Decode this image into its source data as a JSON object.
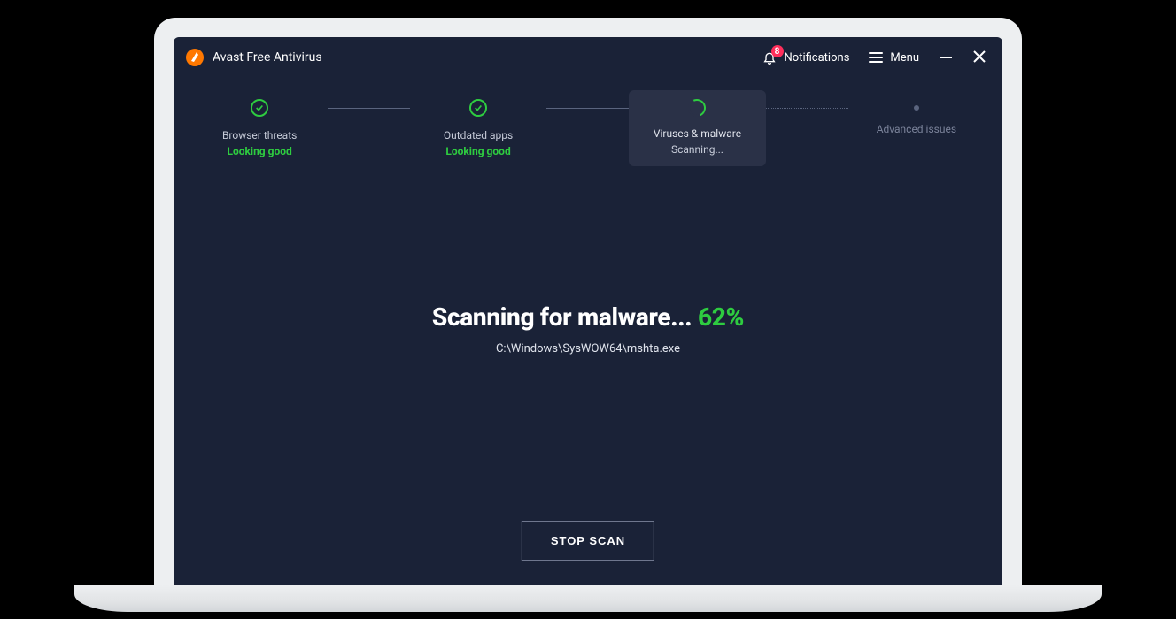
{
  "app": {
    "title": "Avast Free Antivirus"
  },
  "titlebar": {
    "notifications_label": "Notifications",
    "notifications_count": "8",
    "menu_label": "Menu"
  },
  "steps": [
    {
      "label": "Browser threats",
      "status": "Looking good",
      "state": "done"
    },
    {
      "label": "Outdated apps",
      "status": "Looking good",
      "state": "done"
    },
    {
      "label": "Viruses & malware",
      "status": "Scanning...",
      "state": "active"
    },
    {
      "label": "Advanced issues",
      "status": "",
      "state": "pending"
    }
  ],
  "main": {
    "headline_prefix": "Scanning for malware... ",
    "headline_percent": "62%",
    "current_path": "C:\\Windows\\SysWOW64\\mshta.exe",
    "stop_button": "STOP SCAN"
  },
  "colors": {
    "accent_green": "#2ecc40",
    "bg": "#1a2237",
    "badge": "#ff2e5b",
    "logo": "#ff7800"
  }
}
